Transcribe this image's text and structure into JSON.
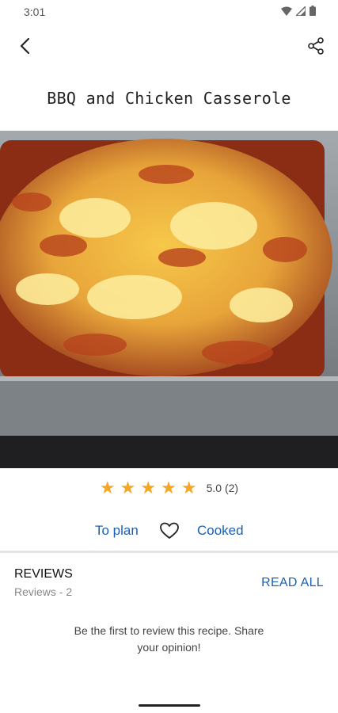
{
  "status_bar": {
    "time": "3:01"
  },
  "recipe": {
    "title": "BBQ and Chicken Casserole"
  },
  "rating": {
    "stars": 5,
    "max_stars": 5,
    "text": "5.0 (2)",
    "star_color": "#f5a623"
  },
  "actions": {
    "to_plan": "To plan",
    "cooked": "Cooked"
  },
  "reviews": {
    "heading": "REVIEWS",
    "count_text": "Reviews - 2",
    "read_all": "READ ALL",
    "empty_message": "Be the first to review this recipe. Share your opinion!"
  },
  "colors": {
    "accent": "#1a5fb4",
    "divider": "#e4e4e4"
  }
}
